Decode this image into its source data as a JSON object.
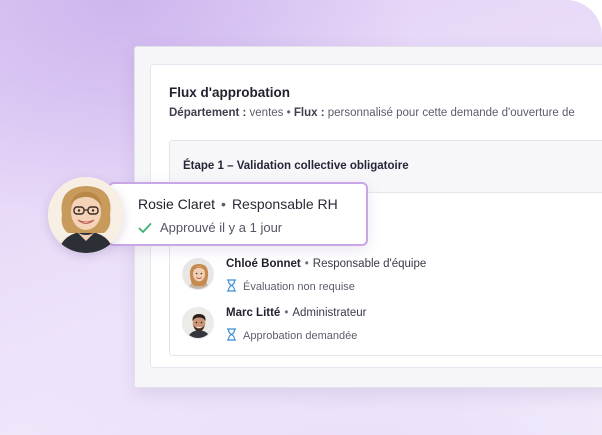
{
  "flux": {
    "title": "Flux d'approbation",
    "department_label": "Département :",
    "department_value": "ventes",
    "separator": "•",
    "flux_label": "Flux :",
    "flux_value": "personnalisé pour cette demande d'ouverture de"
  },
  "step": {
    "title": "Étape 1 – Validation collective obligatoire"
  },
  "highlighted": {
    "name": "Rosie Claret",
    "role": "Responsable RH",
    "status": "Approuvé il y a 1 jour",
    "status_icon": "check-icon",
    "status_color": "#3bb273"
  },
  "approvers": [
    {
      "name": "Chloé Bonnet",
      "role": "Responsable d'équipe",
      "status": "Évaluation non requise",
      "status_icon": "hourglass-icon"
    },
    {
      "name": "Marc Litté",
      "role": "Administrateur",
      "status": "Approbation demandée",
      "status_icon": "hourglass-icon"
    }
  ],
  "colors": {
    "accent_border": "#c9a7e6",
    "hourglass": "#3a8fd6",
    "background_tint": "#e0cdf5"
  }
}
